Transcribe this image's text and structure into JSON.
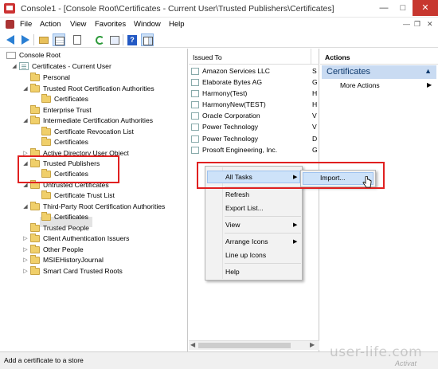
{
  "window": {
    "title": "Console1 - [Console Root\\Certificates - Current User\\Trusted Publishers\\Certificates]",
    "minimize": "—",
    "maximize": "□",
    "close": "✕"
  },
  "menu": [
    "File",
    "Action",
    "View",
    "Favorites",
    "Window",
    "Help"
  ],
  "menu_controls": {
    "minimize": "—",
    "restore": "❐",
    "close": "✕"
  },
  "tree": {
    "items": [
      {
        "label": "Console Root"
      },
      {
        "label": "Certificates - Current User"
      },
      {
        "label": "Personal"
      },
      {
        "label": "Trusted Root Certification Authorities"
      },
      {
        "label": "Certificates"
      },
      {
        "label": "Enterprise Trust"
      },
      {
        "label": "Intermediate Certification Authorities"
      },
      {
        "label": "Certificate Revocation List"
      },
      {
        "label": "Certificates"
      },
      {
        "label": "Active Directory User Object"
      },
      {
        "label": "Trusted Publishers"
      },
      {
        "label": "Certificates"
      },
      {
        "label": "Untrusted Certificates"
      },
      {
        "label": "Certificate Trust List"
      },
      {
        "label": "Third-Party Root Certification Authorities"
      },
      {
        "label": "Certificates"
      },
      {
        "label": "Trusted People"
      },
      {
        "label": "Client Authentication Issuers"
      },
      {
        "label": "Other People"
      },
      {
        "label": "MSIEHistoryJournal"
      },
      {
        "label": "Smart Card Trusted Roots"
      }
    ],
    "glyphs": {
      "expanded": "◢",
      "collapsed": "▷"
    }
  },
  "list": {
    "column_header": "Issued To",
    "rows": [
      {
        "name": "Amazon Services LLC",
        "trunc": "S"
      },
      {
        "name": "Elaborate Bytes AG",
        "trunc": "G"
      },
      {
        "name": "Harmony(Test)",
        "trunc": "H"
      },
      {
        "name": "HarmonyNew(TEST)",
        "trunc": "H"
      },
      {
        "name": "Oracle Corporation",
        "trunc": "V"
      },
      {
        "name": "Power Technology",
        "trunc": "V"
      },
      {
        "name": "Power Technology",
        "trunc": "D"
      },
      {
        "name": "Prosoft Engineering, Inc.",
        "trunc": "G"
      }
    ]
  },
  "actions": {
    "header": "Actions",
    "section": "Certificates",
    "section_arrow": "▲",
    "more": "More Actions",
    "more_arrow": "▶"
  },
  "context_menu": {
    "all_tasks": "All Tasks",
    "refresh": "Refresh",
    "export_list": "Export List...",
    "view": "View",
    "arrange_icons": "Arrange Icons",
    "line_up_icons": "Line up Icons",
    "help": "Help",
    "arrow": "▶"
  },
  "submenu": {
    "import": "Import..."
  },
  "scroll": {
    "left": "◀",
    "right": "▶"
  },
  "status": "Add a certificate to a store",
  "watermark": "user-life.com",
  "activate": "Activat",
  "colors": {
    "highlight_box": "#e02020",
    "selection": "#cde2f9",
    "actions_section": "#c9dbf2"
  }
}
